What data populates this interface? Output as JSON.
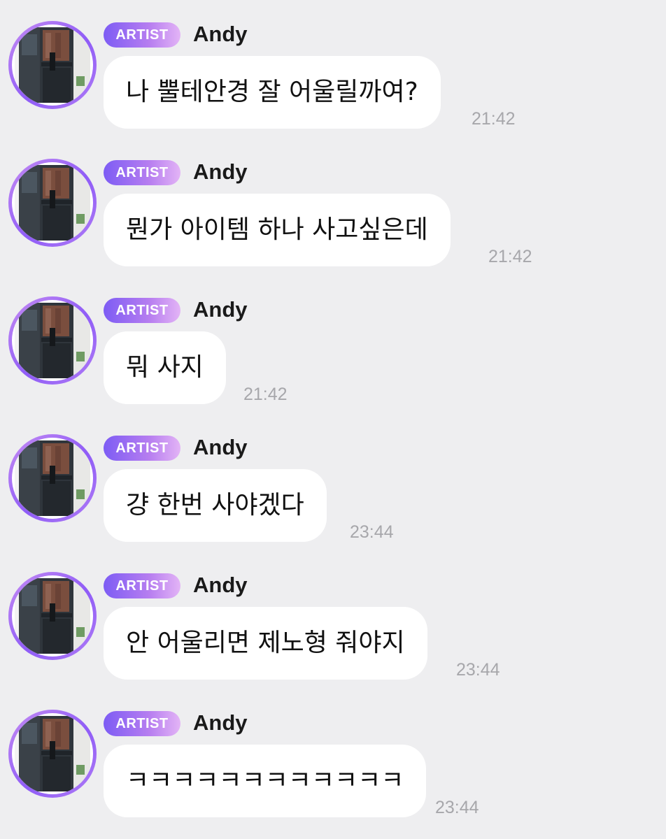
{
  "messages": [
    {
      "badge": "ARTIST",
      "sender": "Andy",
      "text": "나 뿔테안경 잘 어울릴까여?",
      "time": "21:42"
    },
    {
      "badge": "ARTIST",
      "sender": "Andy",
      "text": "뭔가 아이템 하나 사고싶은데",
      "time": "21:42"
    },
    {
      "badge": "ARTIST",
      "sender": "Andy",
      "text": "뭐 사지",
      "time": "21:42"
    },
    {
      "badge": "ARTIST",
      "sender": "Andy",
      "text": "걍 한번 사야겠다",
      "time": "23:44"
    },
    {
      "badge": "ARTIST",
      "sender": "Andy",
      "text": "안 어울리면 제노형 줘야지",
      "time": "23:44"
    },
    {
      "badge": "ARTIST",
      "sender": "Andy",
      "text": "ㅋㅋㅋㅋㅋㅋㅋㅋㅋㅋㅋㅋ",
      "time": "23:44"
    }
  ],
  "colors": {
    "background": "#eeeef0",
    "bubble": "#ffffff",
    "badge_start": "#7d5cf4",
    "badge_end": "#e3b4f6",
    "timestamp": "#a7a7ab"
  },
  "icons": {
    "avatar": "profile-photo-icon"
  }
}
